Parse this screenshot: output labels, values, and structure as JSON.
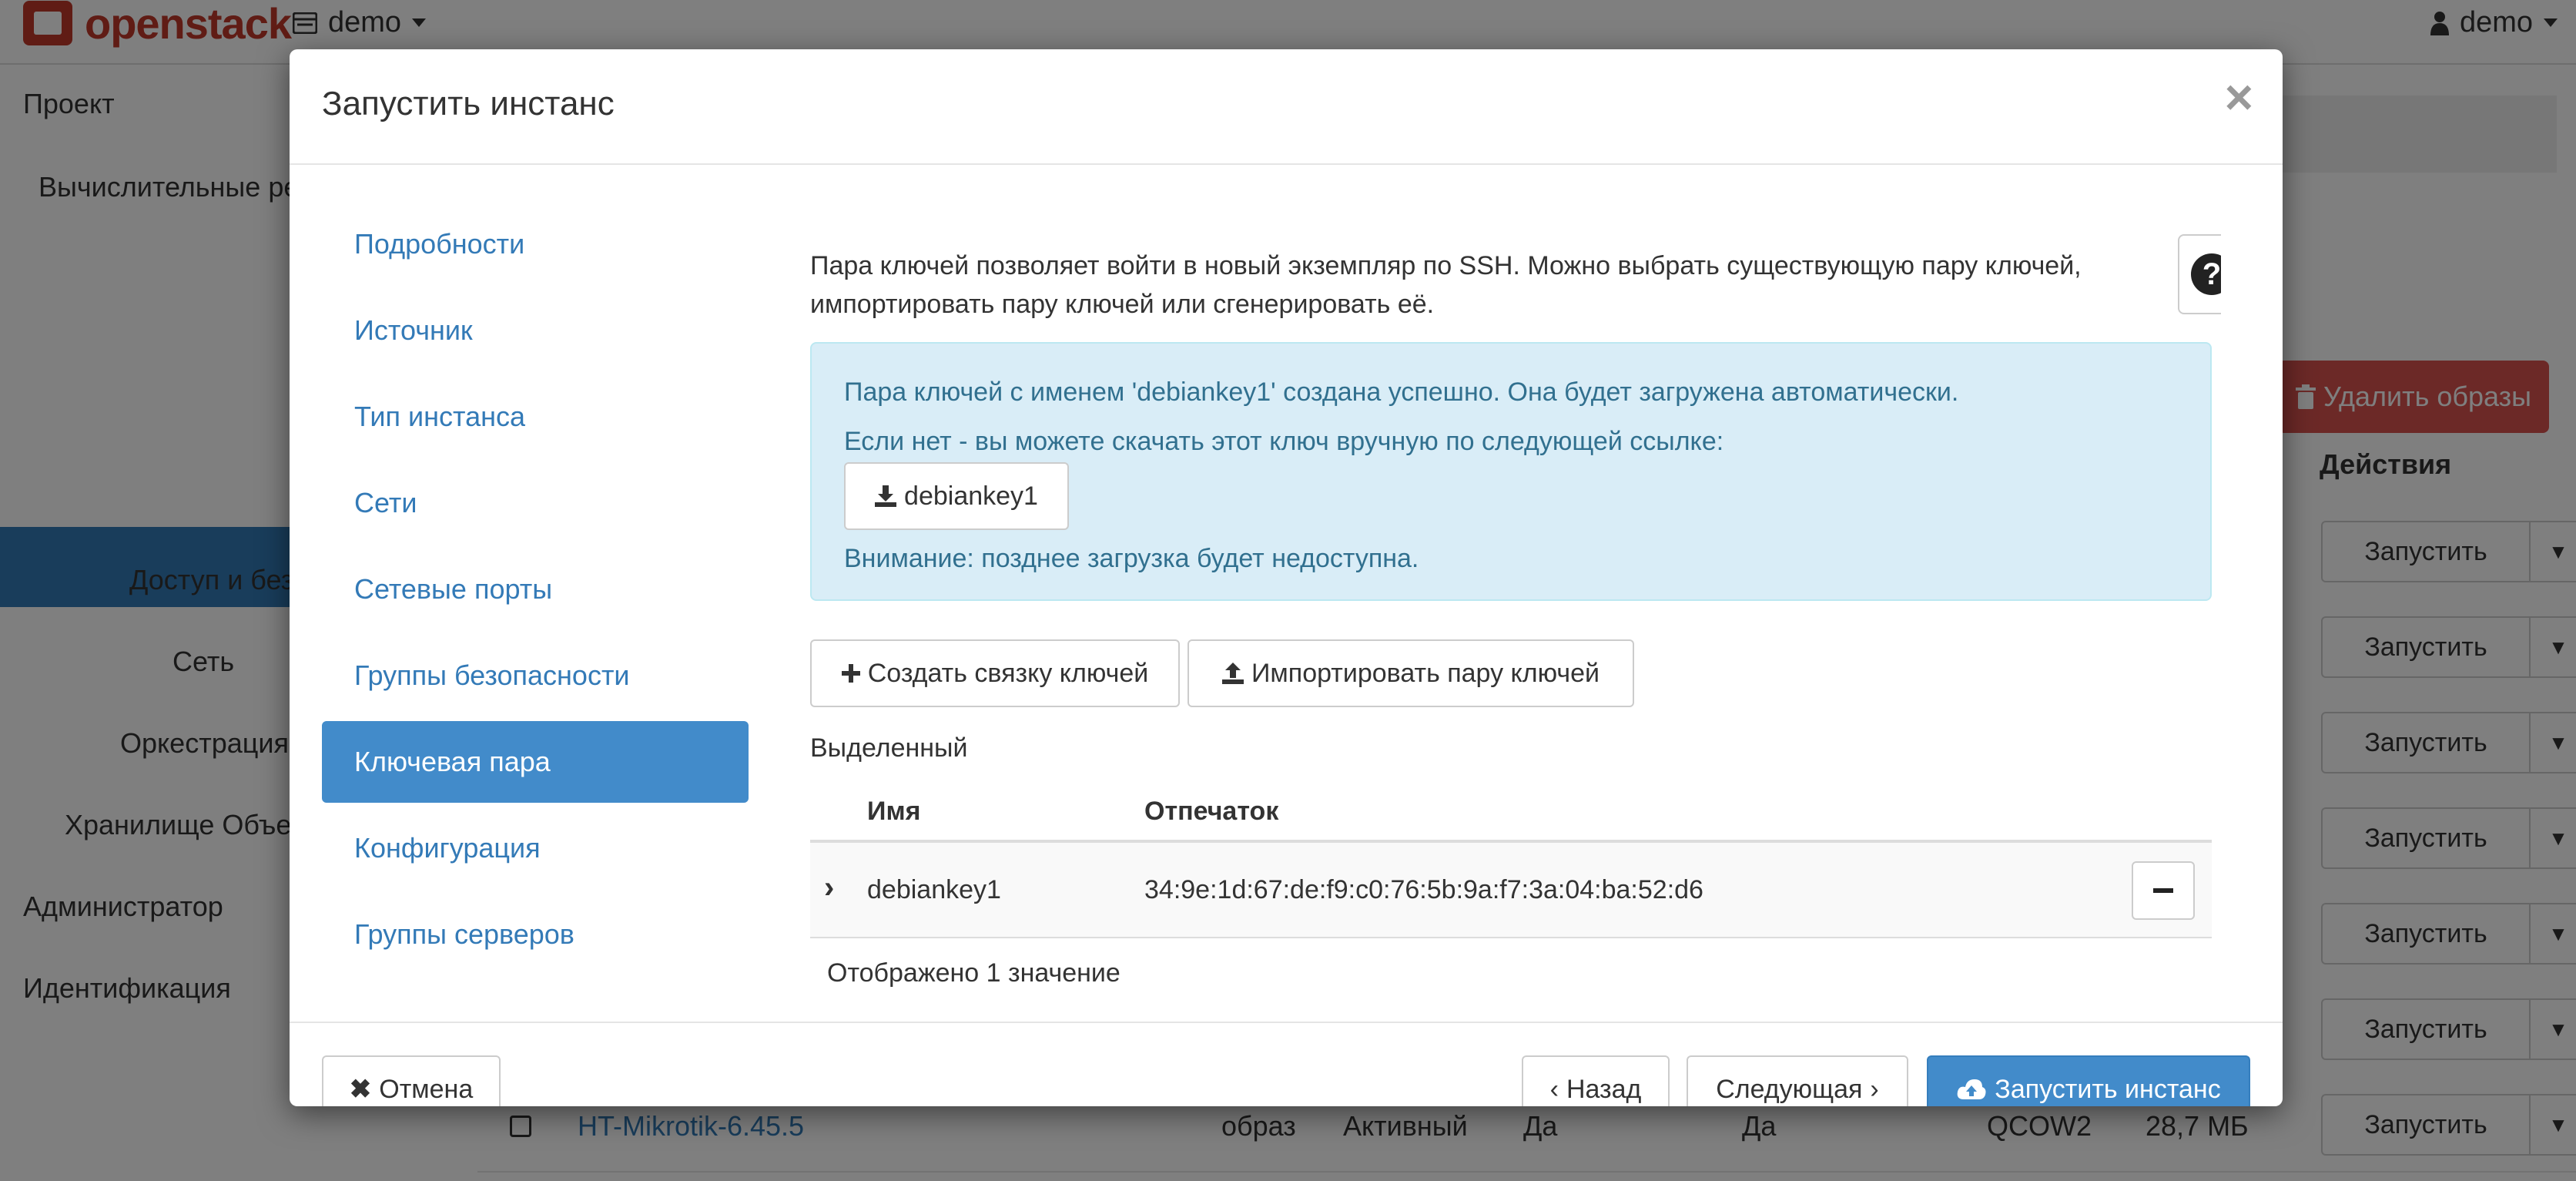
{
  "header": {
    "logo_text": "openstack",
    "project_switch": "demo",
    "user_menu": "demo"
  },
  "sidebar": {
    "project": "Проект",
    "compute": "Вычислительные ре",
    "access": "Доступ и без",
    "network": "Сеть",
    "orchestration": "Оркестрация",
    "object_store": "Хранилище Объе",
    "admin": "Администратор",
    "identity": "Идентификация"
  },
  "background": {
    "delete_images": "Удалить образы",
    "actions_header": "Действия",
    "launch_label": "Запустить",
    "visible_row": {
      "name": "HT-Mikrotik-6.45.5",
      "type": "образ",
      "status": "Активный",
      "public": "Да",
      "protected": "Да",
      "format": "QCOW2",
      "size": "28,7 МБ"
    }
  },
  "modal": {
    "title": "Запустить инстанс",
    "close": "×",
    "nav": [
      "Подробности",
      "Источник",
      "Тип инстанса",
      "Сети",
      "Сетевые порты",
      "Группы безопасности",
      "Ключевая пара",
      "Конфигурация",
      "Группы серверов"
    ],
    "active_nav": "Ключевая пара",
    "intro": "Пара ключей позволяет войти в новый экземпляр по SSH. Можно выбрать существующую пару ключей, импортировать пару ключей или сгенерировать её.",
    "help": "?",
    "alert": {
      "created": "Пара ключей с именем 'debiankey1' создана успешно. Она будет загружена автоматически.",
      "manual": "Если нет - вы можете скачать этот ключ вручную по следующей ссылке:",
      "download_label": "debiankey1",
      "warning": "Внимание: позднее загрузка будет недоступна."
    },
    "create_keypair": "Создать связку ключей",
    "import_keypair": "Импортировать пару ключей",
    "selected_label": "Выделенный",
    "table": {
      "col_name": "Имя",
      "col_fingerprint": "Отпечаток",
      "row": {
        "name": "debiankey1",
        "fingerprint": "34:9e:1d:67:de:f9:c0:76:5b:9a:f7:3a:04:ba:52:d6"
      }
    },
    "count": "Отображено 1 значение",
    "footer": {
      "cancel": "Отмена",
      "back": "Назад",
      "next": "Следующая",
      "launch": "Запустить инстанс"
    }
  },
  "colors": {
    "primary": "#428bca",
    "link": "#337ab7",
    "danger": "#d9534f",
    "info_bg": "#d9edf7",
    "info_text": "#31708f",
    "brand": "#c0392b"
  }
}
